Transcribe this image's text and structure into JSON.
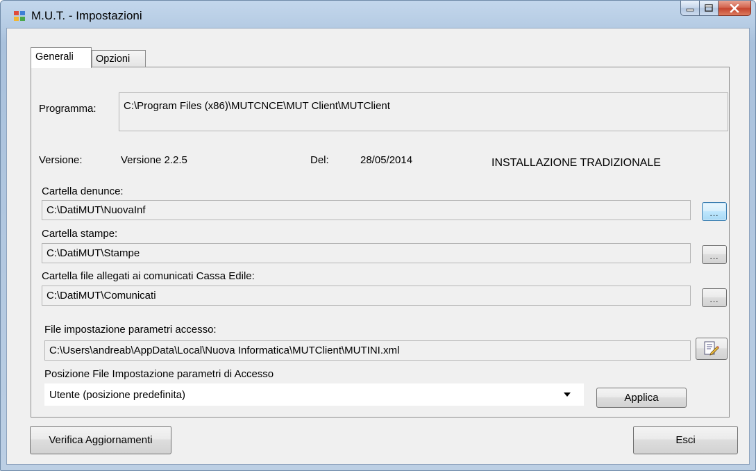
{
  "window": {
    "title": "M.U.T. - Impostazioni"
  },
  "tabs": [
    {
      "label": "Generali",
      "active": true
    },
    {
      "label": "Opzioni",
      "active": false
    }
  ],
  "generali": {
    "programma_label": "Programma:",
    "programma_value": "C:\\Program Files (x86)\\MUTCNCE\\MUT Client\\MUTClient",
    "versione_label": "Versione:",
    "versione_value": "Versione 2.2.5",
    "del_label": "Del:",
    "del_value": "28/05/2014",
    "installazione": "INSTALLAZIONE TRADIZIONALE",
    "cartella_denunce_label": "Cartella denunce:",
    "cartella_denunce_value": "C:\\DatiMUT\\NuovaInf",
    "cartella_stampe_label": "Cartella stampe:",
    "cartella_stampe_value": "C:\\DatiMUT\\Stampe",
    "cartella_allegati_label": "Cartella file allegati ai comunicati Cassa Edile:",
    "cartella_allegati_value": "C:\\DatiMUT\\Comunicati",
    "file_impostazione_label": "File impostazione parametri accesso:",
    "file_impostazione_value": "C:\\Users\\andreab\\AppData\\Local\\Nuova Informatica\\MUTClient\\MUTINI.xml",
    "posizione_label": "Posizione File Impostazione parametri di Accesso",
    "posizione_value": "Utente (posizione predefinita)",
    "browse_label": "...",
    "applica_label": "Applica"
  },
  "footer": {
    "verifica_label": "Verifica Aggiornamenti",
    "esci_label": "Esci"
  },
  "colors": {
    "titlebar": "#b6cce4",
    "client": "#f0f0f0",
    "close_button": "#c3422c"
  }
}
